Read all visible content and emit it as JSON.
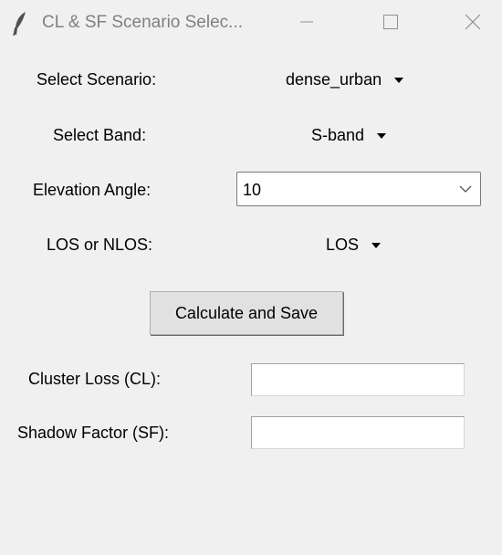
{
  "window": {
    "title": "CL & SF Scenario Selec...",
    "icon": "feather-icon",
    "controls": [
      "minimize-icon",
      "maximize-icon",
      "close-icon"
    ]
  },
  "scenario": {
    "label": "Select Scenario:",
    "value": "dense_urban"
  },
  "band": {
    "label": "Select Band:",
    "value": "S-band"
  },
  "elevation": {
    "label": "Elevation Angle:",
    "value": "10"
  },
  "los": {
    "label": "LOS or NLOS:",
    "value": "LOS"
  },
  "calculate_button": {
    "label": "Calculate and Save"
  },
  "cluster_loss": {
    "label": "Cluster Loss (CL):",
    "value": ""
  },
  "shadow_factor": {
    "label": "Shadow Factor (SF):",
    "value": ""
  }
}
